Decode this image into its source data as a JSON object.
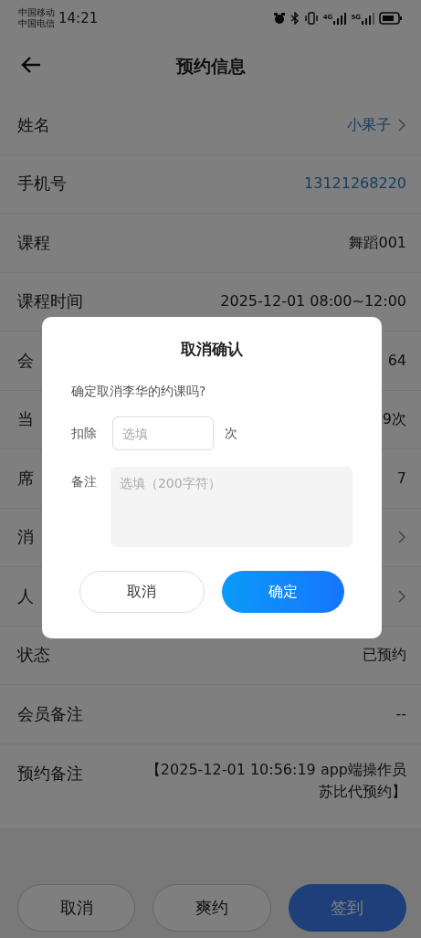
{
  "status_bar": {
    "carriers": [
      "中国移动",
      "中国电信"
    ],
    "time": "14:21",
    "network_1": "4G",
    "network_2": "5G"
  },
  "header": {
    "title": "预约信息"
  },
  "rows": [
    {
      "label": "姓名",
      "value": "小果子",
      "kind": "link",
      "chevron": true
    },
    {
      "label": "手机号",
      "value": "13121268220",
      "kind": "link",
      "chevron": false
    },
    {
      "label": "课程",
      "value": "舞蹈001",
      "kind": "plain",
      "chevron": false
    },
    {
      "label": "课程时间",
      "value": "2025-12-01 08:00~12:00",
      "kind": "plain",
      "chevron": false
    },
    {
      "label": "会",
      "value": "64",
      "kind": "plain",
      "chevron": false
    },
    {
      "label": "当",
      "value": "9次",
      "kind": "plain",
      "chevron": false
    },
    {
      "label": "席",
      "value": "7",
      "kind": "plain",
      "chevron": false
    },
    {
      "label": "消",
      "chevron": true
    },
    {
      "label": "人",
      "chevron": true
    },
    {
      "label": "状态",
      "value": "已预约",
      "kind": "plain",
      "chevron": false
    },
    {
      "label": "会员备注",
      "value": "--",
      "kind": "plain",
      "chevron": false
    },
    {
      "label": "预约备注",
      "value": "【2025-12-01 10:56:19 app端操作员苏比代预约】",
      "kind": "plain",
      "chevron": false
    }
  ],
  "bottom_buttons": [
    {
      "label": "取消",
      "kind": "outline"
    },
    {
      "label": "爽约",
      "kind": "outline"
    },
    {
      "label": "签到",
      "kind": "primary"
    }
  ],
  "dialog": {
    "title": "取消确认",
    "message": "确定取消李华的约课吗?",
    "deduct_label": "扣除",
    "deduct_placeholder": "选填",
    "deduct_unit": "次",
    "note_label": "备注",
    "note_placeholder": "选填（200字符）",
    "buttons": [
      {
        "label": "取消",
        "kind": "outline"
      },
      {
        "label": "确定",
        "kind": "primary"
      }
    ]
  }
}
